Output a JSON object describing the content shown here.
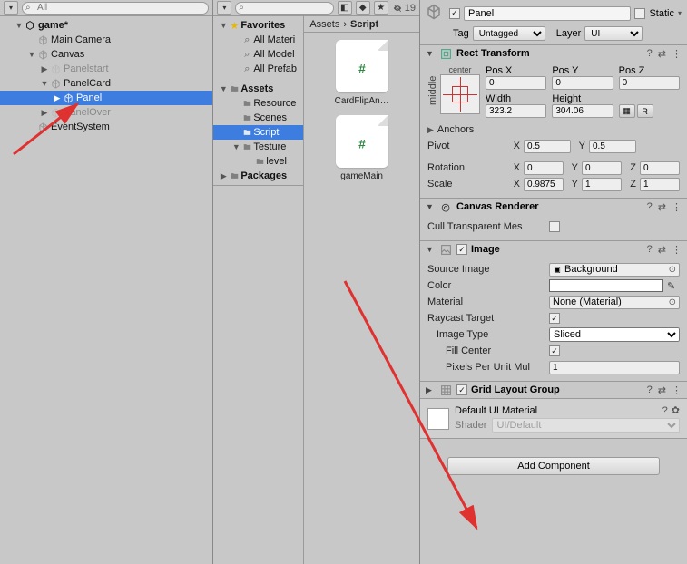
{
  "hierarchy": {
    "search_placeholder": "All",
    "scene": "game*",
    "items": [
      {
        "label": "Main Camera"
      },
      {
        "label": "Canvas"
      },
      {
        "label": "Panelstart"
      },
      {
        "label": "PanelCard"
      },
      {
        "label": "Panel"
      },
      {
        "label": "PanelOver"
      },
      {
        "label": "EventSystem"
      }
    ]
  },
  "project": {
    "search_placeholder": "",
    "visibility_count": "19",
    "favorites": "Favorites",
    "fav_items": [
      "All Materi",
      "All Model",
      "All Prefab"
    ],
    "assets": "Assets",
    "asset_folders": [
      "Resource",
      "Scenes",
      "Script",
      "Testure",
      "level"
    ],
    "packages": "Packages",
    "breadcrumb": [
      "Assets",
      "Script"
    ],
    "grid": [
      {
        "label": "CardFlipAn…"
      },
      {
        "label": "gameMain"
      }
    ]
  },
  "inspector": {
    "name": "Panel",
    "static_label": "Static",
    "tag_label": "Tag",
    "tag_value": "Untagged",
    "layer_label": "Layer",
    "layer_value": "UI",
    "rect": {
      "title": "Rect Transform",
      "anchor_preset_h": "center",
      "anchor_preset_v": "middle",
      "posx_label": "Pos X",
      "posx": "0",
      "posy_label": "Pos Y",
      "posy": "0",
      "posz_label": "Pos Z",
      "posz": "0",
      "width_label": "Width",
      "width": "323.2",
      "height_label": "Height",
      "height": "304.06",
      "anchors_label": "Anchors",
      "pivot_label": "Pivot",
      "pivot_x": "0.5",
      "pivot_y": "0.5",
      "rotation_label": "Rotation",
      "rot_x": "0",
      "rot_y": "0",
      "rot_z": "0",
      "scale_label": "Scale",
      "scale_x": "0.9875",
      "scale_y": "1",
      "scale_z": "1",
      "r_btn": "R"
    },
    "canvas_renderer": {
      "title": "Canvas Renderer",
      "cull_label": "Cull Transparent Mes"
    },
    "image": {
      "title": "Image",
      "source_label": "Source Image",
      "source_value": "Background",
      "color_label": "Color",
      "material_label": "Material",
      "material_value": "None (Material)",
      "raycast_label": "Raycast Target",
      "type_label": "Image Type",
      "type_value": "Sliced",
      "fill_label": "Fill Center",
      "ppu_label": "Pixels Per Unit Mul",
      "ppu_value": "1"
    },
    "grid_layout": {
      "title": "Grid Layout Group"
    },
    "material": {
      "name": "Default UI Material",
      "shader_label": "Shader",
      "shader_value": "UI/Default"
    },
    "add_component": "Add Component"
  },
  "chart_data": null
}
